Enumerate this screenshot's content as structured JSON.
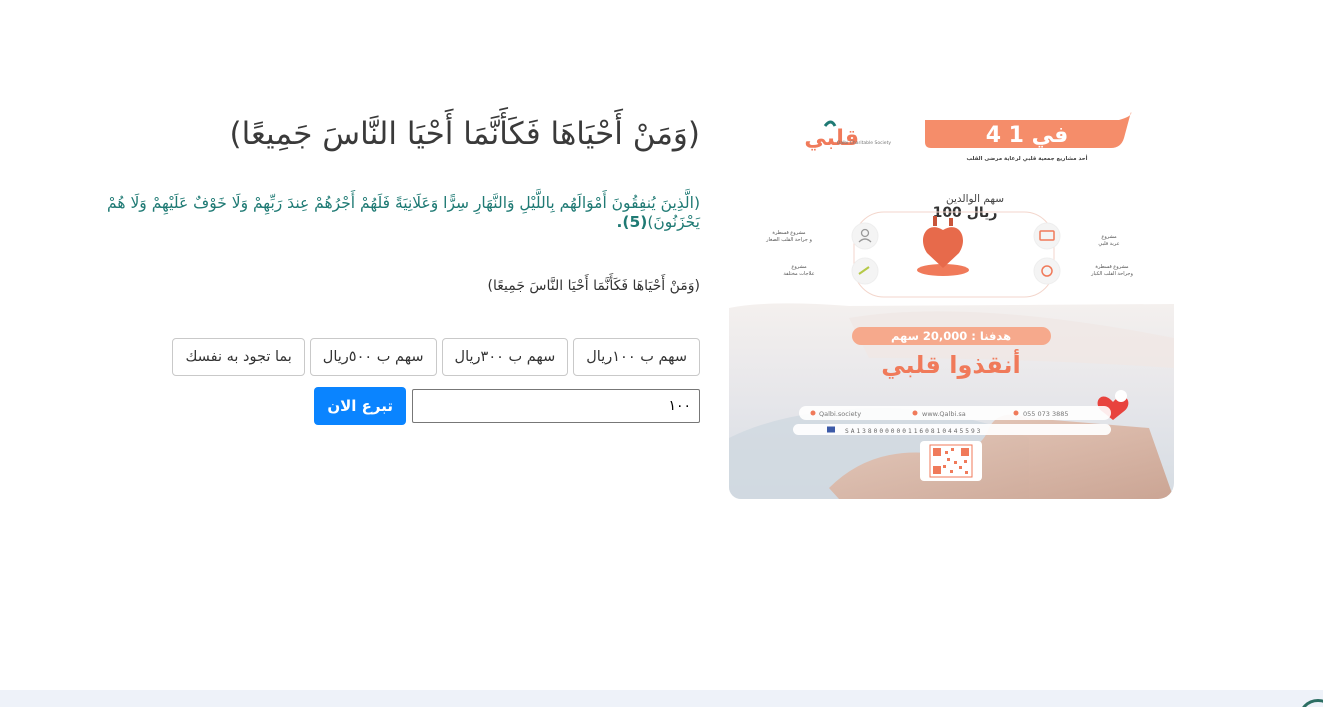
{
  "content": {
    "title": "(وَمَنْ أَحْيَاهَا فَكَأَنَّمَا أَحْيَا النَّاسَ جَمِيعًا)",
    "verse_text": "(الَّذِينَ يُنفِقُونَ أَمْوَالَهُم بِاللَّيْلِ وَالنَّهَارِ سِرًّا وَعَلَانِيَةً فَلَهُمْ أَجْرُهُمْ عِندَ رَبِّهِمْ وَلَا خَوْفٌ عَلَيْهِمْ وَلَا هُمْ يَحْزَنُونَ)",
    "verse_number": "(5).",
    "subtitle": "(وَمَنْ أَحْيَاهَا فَكَأَنَّمَا أَحْيَا النَّاسَ جَمِيعًا)"
  },
  "shares": [
    {
      "label": "سهم ب ١٠٠ريال"
    },
    {
      "label": "سهم ب ٣٠٠ريال"
    },
    {
      "label": "سهم ب ٥٠٠ريال"
    },
    {
      "label": "بما تجود به نفسك"
    }
  ],
  "donate": {
    "amount_value": "١٠٠",
    "button_label": "تبرع الان"
  },
  "poster": {
    "logo_text": "قلبي",
    "logo_subtitle": "Qalbi Charitable Society",
    "badge_text": "4 في 1",
    "badge_subtitle": "أحد مشاريع جمعية قلبي لرعاية مرضى القلب",
    "parents_share_label": "سهم الوالدين",
    "parents_share_amount": "100 ريال",
    "goal_text": "هدفنا : 20,000 سهم",
    "headline": "أنقذوا قلبي",
    "contact_1": "Qalbi.society",
    "contact_2": "www.Qalbi.sa",
    "contact_3": "055 073 3885",
    "iban": "SA1380000001160810445593",
    "colors": {
      "accent": "#f07a5a",
      "accent_light": "#f6a98c",
      "badge": "#f58d6a",
      "brand_teal": "#1f7a74",
      "donate_blue": "#0a84ff"
    }
  }
}
